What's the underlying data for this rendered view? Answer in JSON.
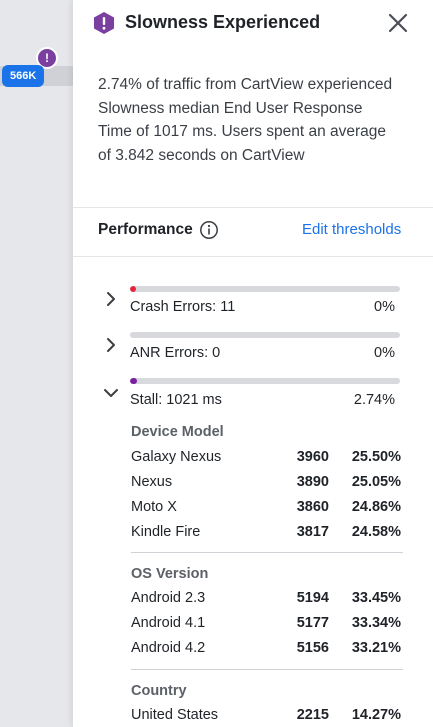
{
  "background": {
    "pill_value": "566K",
    "alert_glyph": "!"
  },
  "panel": {
    "title": "Slowness Experienced",
    "icon": "warning-hexagon-icon",
    "description": "2.74% of traffic from CartView experienced Slowness median End User Response Time of 1017 ms. Users spent an average of 3.842 seconds on CartView",
    "performance_label": "Performance",
    "edit_thresholds": "Edit thresholds"
  },
  "metrics": [
    {
      "label": "Crash Errors: 11",
      "pct": "0%",
      "expanded": false,
      "fill_fraction": 0.02,
      "color": "#e8223a"
    },
    {
      "label": "ANR Errors: 0",
      "pct": "0%",
      "expanded": false,
      "fill_fraction": 0.0,
      "color": "#9aa0a6"
    },
    {
      "label": "Stall: 1021 ms",
      "pct": "2.74%",
      "expanded": true,
      "fill_fraction": 0.0274,
      "color": "#7b1fa2"
    }
  ],
  "stall_breakdown": {
    "device": {
      "title": "Device Model",
      "rows": [
        {
          "name": "Galaxy Nexus",
          "count": "3960",
          "pct": "25.50%"
        },
        {
          "name": "Nexus",
          "count": "3890",
          "pct": "25.05%"
        },
        {
          "name": "Moto X",
          "count": "3860",
          "pct": "24.86%"
        },
        {
          "name": "Kindle Fire",
          "count": "3817",
          "pct": "24.58%"
        }
      ]
    },
    "os": {
      "title": "OS Version",
      "rows": [
        {
          "name": "Android 2.3",
          "count": "5194",
          "pct": "33.45%"
        },
        {
          "name": "Android 4.1",
          "count": "5177",
          "pct": "33.34%"
        },
        {
          "name": "Android 4.2",
          "count": "5156",
          "pct": "33.21%"
        }
      ]
    },
    "country": {
      "title": "Country",
      "rows": [
        {
          "name": "United States",
          "count": "2215",
          "pct": "14.27%"
        }
      ]
    }
  },
  "colors": {
    "accent": "#1a73e8",
    "alert_purple": "#7b3fa0",
    "crash_red": "#e8223a",
    "stall_purple": "#7b1fa2"
  }
}
